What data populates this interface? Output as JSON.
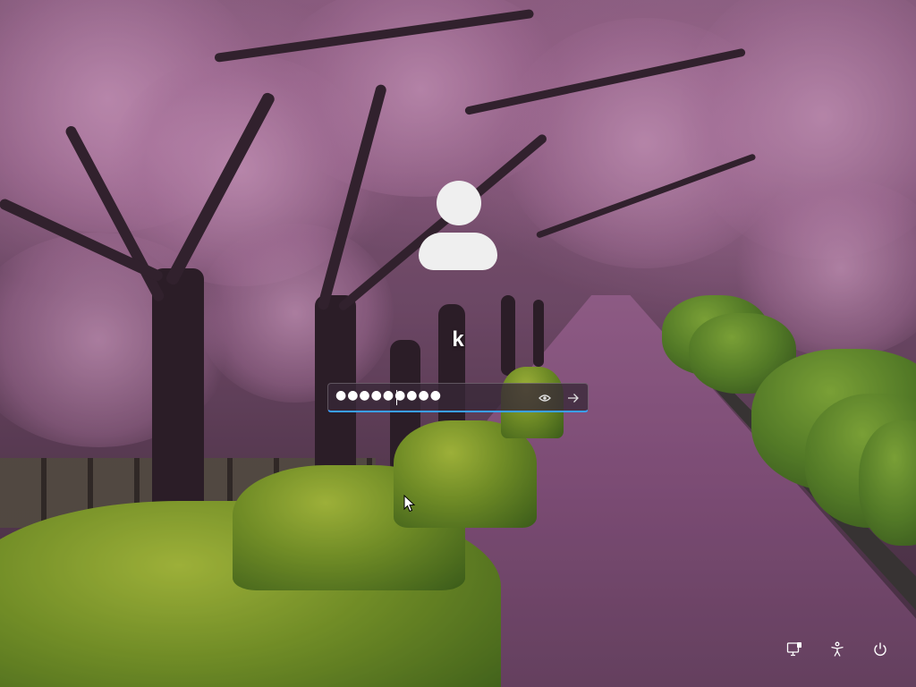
{
  "lock_screen": {
    "user": {
      "name": "k"
    },
    "password": {
      "masked_value": "●●●●●●●●●",
      "reveal_icon": "eye-icon",
      "submit_icon": "arrow-right-icon"
    },
    "colors": {
      "accent": "#3aa0ff",
      "text": "#ffffff",
      "avatar": "#efefef"
    }
  },
  "system_tray": {
    "icons": [
      "network-icon",
      "accessibility-icon",
      "power-icon"
    ]
  }
}
